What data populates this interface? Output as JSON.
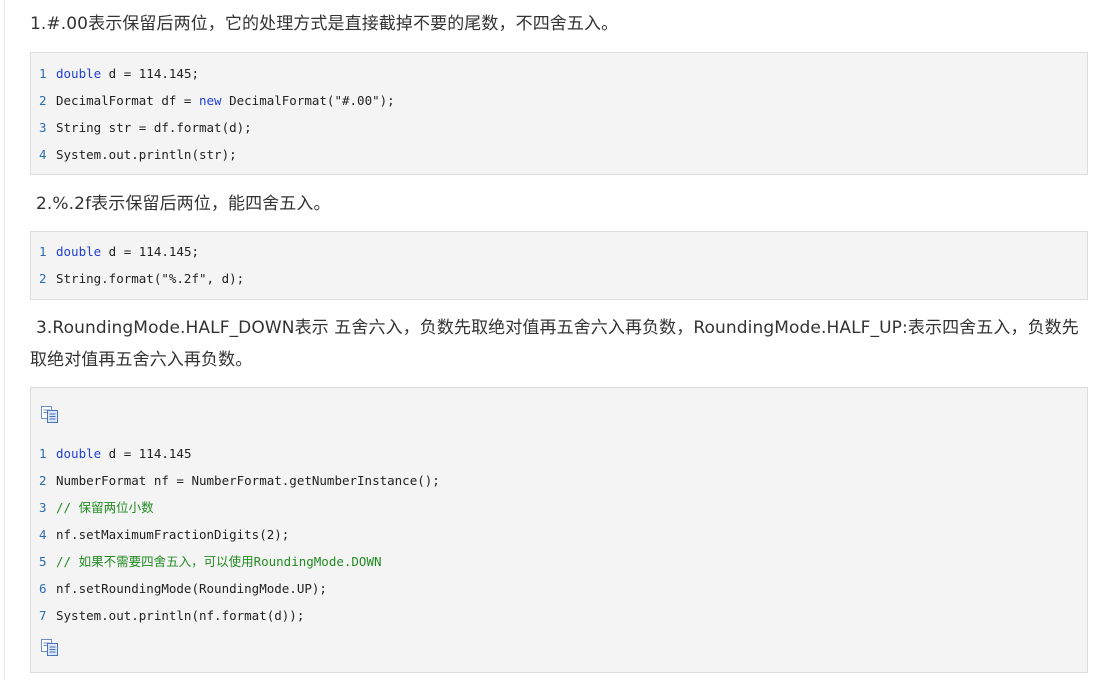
{
  "sections": [
    {
      "heading": "1.#.00表示保留后两位，它的处理方式是直接截掉不要的尾数，不四舍五入。",
      "lines": [
        {
          "num": "1",
          "kw": "double",
          "text": " d = 114.145;"
        },
        {
          "num": "2",
          "pre": "DecimalFormat df = ",
          "kw": "new",
          "text": " DecimalFormat(\"#.00\");"
        },
        {
          "num": "3",
          "text": "String str = df.format(d);"
        },
        {
          "num": "4",
          "text": "System.out.println(str);"
        }
      ]
    },
    {
      "heading": "2.%.2f表示保留后两位，能四舍五入。",
      "lines": [
        {
          "num": "1",
          "kw": "double",
          "text": " d = 114.145;"
        },
        {
          "num": "2",
          "text": "String.format(\"%.2f\", d);"
        }
      ]
    },
    {
      "heading": "3.RoundingMode.HALF_DOWN表示 五舍六入，负数先取绝对值再五舍六入再负数，RoundingMode.HALF_UP:表示四舍五入，负数先取绝对值再五舍六入再负数。",
      "lines": [
        {
          "num": "1",
          "kw": "double",
          "text": " d = 114.145"
        },
        {
          "num": "2",
          "text": "NumberFormat nf = NumberFormat.getNumberInstance();"
        },
        {
          "num": "3",
          "comment": "// 保留两位小数"
        },
        {
          "num": "4",
          "text": "nf.setMaximumFractionDigits(2);"
        },
        {
          "num": "5",
          "comment": "// 如果不需要四舍五入，可以使用RoundingMode.DOWN"
        },
        {
          "num": "6",
          "text": "nf.setRoundingMode(RoundingMode.UP);"
        },
        {
          "num": "7",
          "text": "System.out.println(nf.format(d));"
        }
      ]
    }
  ],
  "icons": {
    "copy": "copy-code-icon"
  },
  "colors": {
    "keyword": "#1f3fd1",
    "comment": "#228b22",
    "line_number": "#2b6cb0",
    "code_bg": "#f4f4f4"
  }
}
